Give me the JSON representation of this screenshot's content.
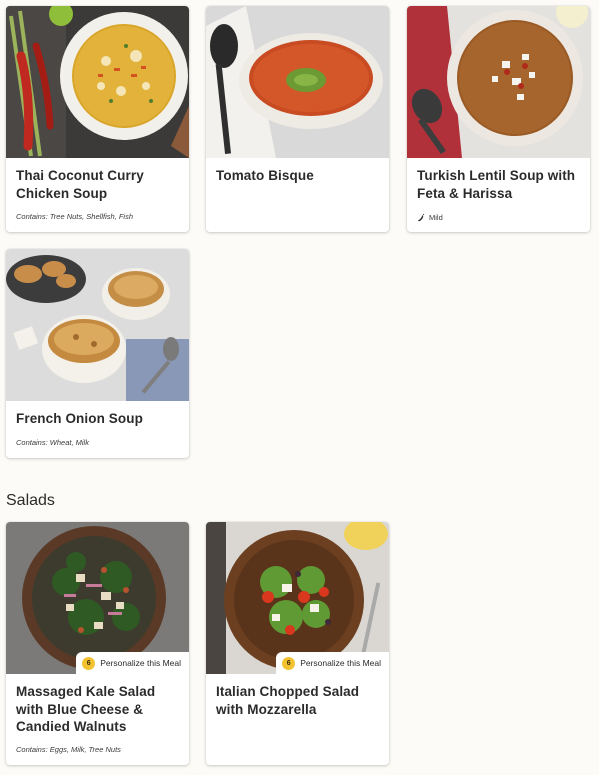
{
  "soups": [
    {
      "title": "Thai Coconut Curry Chicken Soup",
      "contains": "Contains: Tree Nuts, Shellfish, Fish"
    },
    {
      "title": "Tomato Bisque"
    },
    {
      "title": "Turkish Lentil Soup with Feta & Harissa",
      "spice": "Mild"
    },
    {
      "title": "French Onion Soup",
      "contains": "Contains: Wheat, Milk"
    }
  ],
  "salads_section": {
    "title": "Salads"
  },
  "salads": [
    {
      "title": "Massaged Kale Salad with Blue Cheese & Candied Walnuts",
      "contains": "Contains: Eggs, Milk, Tree Nuts",
      "badge": "6",
      "personalize": "Personalize this Meal"
    },
    {
      "title": "Italian Chopped Salad with Mozzarella",
      "badge": "6",
      "personalize": "Personalize this Meal"
    }
  ],
  "icons": {
    "spice": "chili-pepper-icon",
    "badge": "customize-count-badge"
  }
}
